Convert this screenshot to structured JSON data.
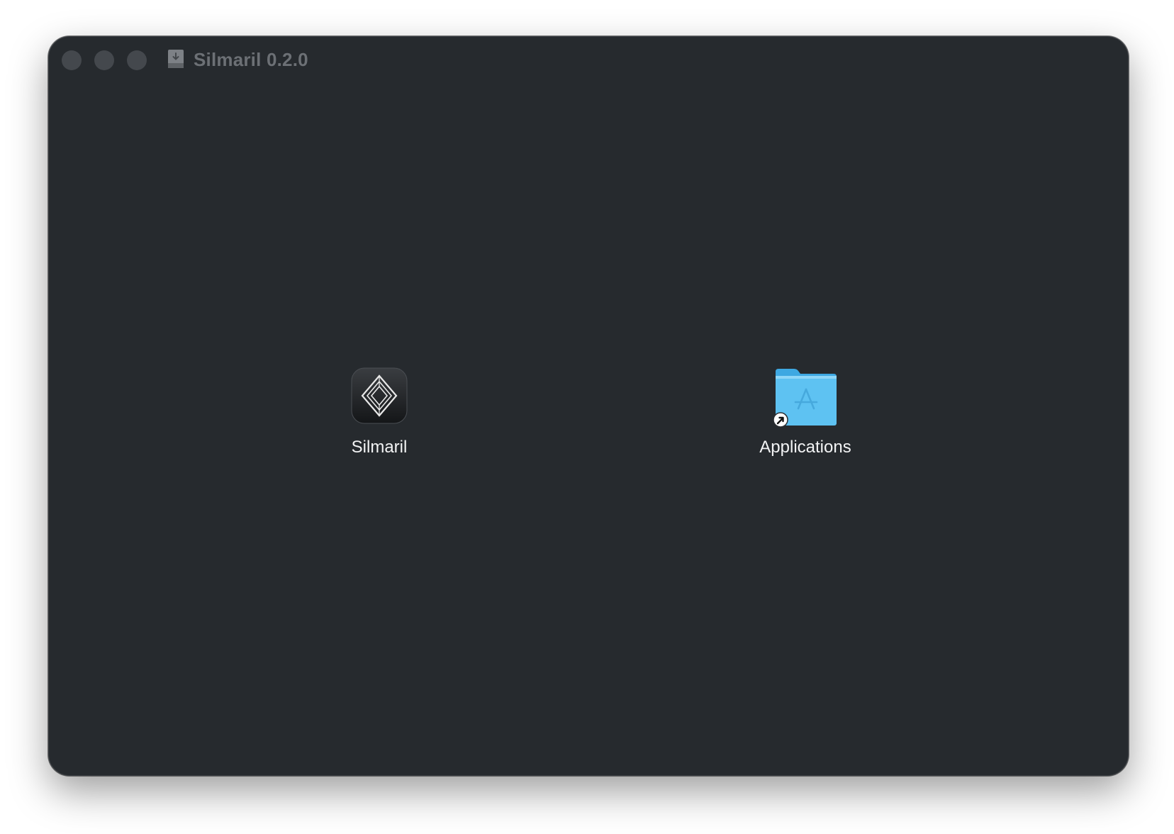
{
  "window": {
    "title": "Silmaril 0.2.0",
    "background_color": "#262a2e"
  },
  "title_bar": {
    "disk_icon": "disk-image-icon",
    "buttons": [
      "close",
      "minimize",
      "zoom"
    ]
  },
  "items": [
    {
      "label": "Silmaril",
      "icon": "silmaril-app-icon"
    },
    {
      "label": "Applications",
      "icon": "applications-folder-alias-icon"
    }
  ],
  "colors": {
    "folder_blue": "#5ec2f2",
    "title_text": "#6c7075",
    "label_text": "#f2f3f4"
  }
}
